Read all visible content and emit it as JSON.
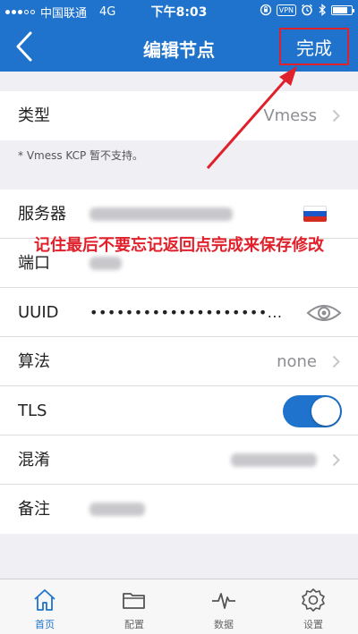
{
  "status_bar": {
    "carrier": "中国联通",
    "network": "4G",
    "time": "下午8:03",
    "vpn_badge": "VPN",
    "battery_level": 0.8
  },
  "nav": {
    "title": "编辑节点",
    "done_label": "完成"
  },
  "fields": {
    "type": {
      "label": "类型",
      "value": "Vmess"
    },
    "note": "* Vmess KCP 暂不支持。",
    "server": {
      "label": "服务器"
    },
    "port": {
      "label": "端口"
    },
    "uuid": {
      "label": "UUID",
      "value": "••••••••••••••••••••..."
    },
    "algorithm": {
      "label": "算法",
      "value": "none"
    },
    "tls": {
      "label": "TLS",
      "enabled": true
    },
    "obfs": {
      "label": "混淆"
    },
    "remark": {
      "label": "备注"
    }
  },
  "annotation": {
    "text": "记住最后不要忘记返回点完成来保存修改",
    "color": "#e0202a"
  },
  "tabbar": {
    "items": [
      {
        "label": "首页",
        "icon": "home-icon",
        "active": true
      },
      {
        "label": "配置",
        "icon": "folder-icon",
        "active": false
      },
      {
        "label": "数据",
        "icon": "pulse-icon",
        "active": false
      },
      {
        "label": "设置",
        "icon": "gear-icon",
        "active": false
      }
    ]
  },
  "colors": {
    "primary": "#1f73cc",
    "background": "#efeff4",
    "annotation": "#e0202a"
  }
}
